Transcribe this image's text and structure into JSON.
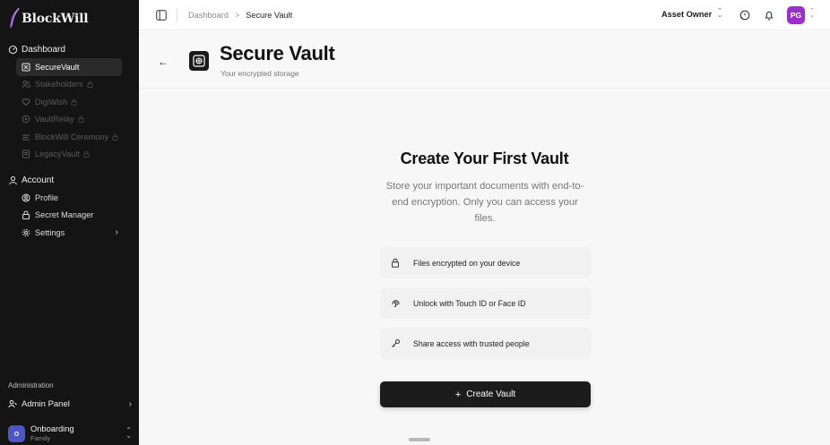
{
  "brand": {
    "name": "BlockWill"
  },
  "sidebar": {
    "dashboard": {
      "label": "Dashboard",
      "items": [
        {
          "label": "SecureVault",
          "icon": "vault-icon",
          "active": true,
          "locked": false
        },
        {
          "label": "Stakeholders",
          "icon": "users-icon",
          "active": false,
          "locked": true
        },
        {
          "label": "DigiWish",
          "icon": "heart-icon",
          "active": false,
          "locked": true
        },
        {
          "label": "VaultRelay",
          "icon": "relay-icon",
          "active": false,
          "locked": true
        },
        {
          "label": "BlockWill Ceremony",
          "icon": "ceremony-icon",
          "active": false,
          "locked": true
        },
        {
          "label": "LegacyVault",
          "icon": "legacy-icon",
          "active": false,
          "locked": true
        }
      ]
    },
    "account": {
      "label": "Account",
      "items": [
        {
          "label": "Profile",
          "icon": "profile-icon"
        },
        {
          "label": "Secret Manager",
          "icon": "lock-icon"
        },
        {
          "label": "Settings",
          "icon": "gear-icon"
        }
      ]
    },
    "administration": {
      "label": "Administration",
      "admin_panel": "Admin Panel"
    },
    "workspace": {
      "name": "Onboarding",
      "subtitle": "Family"
    }
  },
  "topbar": {
    "breadcrumb": {
      "parent": "Dashboard",
      "separator": ">",
      "current": "Secure Vault"
    },
    "role": "Asset Owner",
    "user_initials": "PG"
  },
  "page": {
    "title": "Secure Vault",
    "subtitle": "Your encrypted storage"
  },
  "empty_state": {
    "title": "Create Your First Vault",
    "description": "Store your important documents with end-to-end encryption. Only you can access your files.",
    "features": [
      {
        "text": "Files encrypted on your device",
        "icon": "lock-icon"
      },
      {
        "text": "Unlock with Touch ID or Face ID",
        "icon": "fingerprint-icon"
      },
      {
        "text": "Share access with trusted people",
        "icon": "key-icon"
      }
    ],
    "cta": {
      "plus": "+",
      "label": "Create Vault"
    }
  },
  "colors": {
    "sidebar_bg": "#141414",
    "accent_avatar": "#9b2fc9",
    "workspace_avatar": "#4e55c7",
    "cta_bg": "#1c1c1c"
  }
}
